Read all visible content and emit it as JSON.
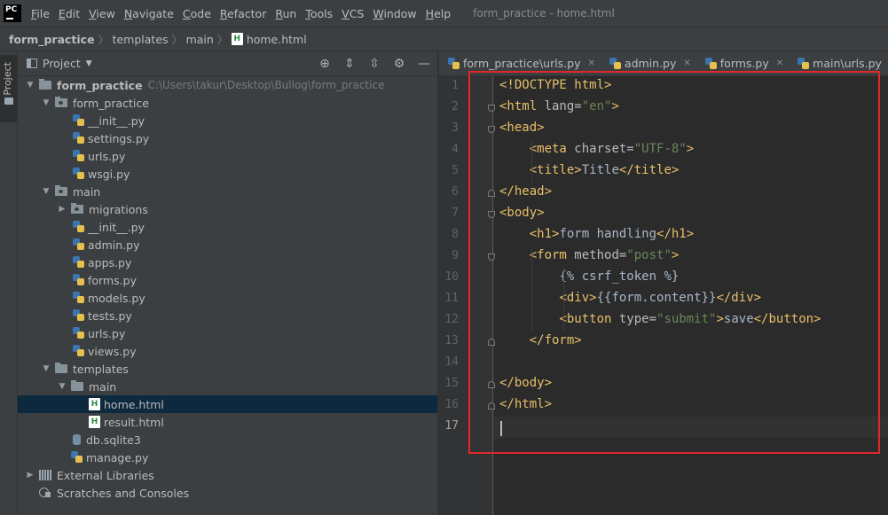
{
  "app": {
    "logo": "PC",
    "window_title": "form_practice - home.html"
  },
  "menu": [
    "File",
    "Edit",
    "View",
    "Navigate",
    "Code",
    "Refactor",
    "Run",
    "Tools",
    "VCS",
    "Window",
    "Help"
  ],
  "breadcrumb": [
    "form_practice",
    "templates",
    "main",
    "home.html"
  ],
  "sidebar_stripe": {
    "label": "Project"
  },
  "project_panel": {
    "title": "Project",
    "tree": [
      {
        "label": "form_practice",
        "path": "C:\\Users\\takur\\Desktop\\Bullog\\form_practice",
        "bold": true,
        "depth": 0,
        "expanded": true,
        "icon": "folder"
      },
      {
        "label": "form_practice",
        "depth": 1,
        "expanded": true,
        "icon": "package"
      },
      {
        "label": "__init__.py",
        "depth": 3,
        "icon": "python"
      },
      {
        "label": "settings.py",
        "depth": 3,
        "icon": "python"
      },
      {
        "label": "urls.py",
        "depth": 3,
        "icon": "python"
      },
      {
        "label": "wsgi.py",
        "depth": 3,
        "icon": "python"
      },
      {
        "label": "main",
        "depth": 1,
        "expanded": true,
        "icon": "package"
      },
      {
        "label": "migrations",
        "depth": 2,
        "expanded": false,
        "icon": "package"
      },
      {
        "label": "__init__.py",
        "depth": 3,
        "icon": "python"
      },
      {
        "label": "admin.py",
        "depth": 3,
        "icon": "python"
      },
      {
        "label": "apps.py",
        "depth": 3,
        "icon": "python"
      },
      {
        "label": "forms.py",
        "depth": 3,
        "icon": "python"
      },
      {
        "label": "models.py",
        "depth": 3,
        "icon": "python"
      },
      {
        "label": "tests.py",
        "depth": 3,
        "icon": "python"
      },
      {
        "label": "urls.py",
        "depth": 3,
        "icon": "python"
      },
      {
        "label": "views.py",
        "depth": 3,
        "icon": "python"
      },
      {
        "label": "templates",
        "depth": 1,
        "expanded": true,
        "icon": "folder"
      },
      {
        "label": "main",
        "depth": 2,
        "expanded": true,
        "icon": "folder"
      },
      {
        "label": "home.html",
        "depth": 4,
        "icon": "html",
        "selected": true
      },
      {
        "label": "result.html",
        "depth": 4,
        "icon": "html"
      },
      {
        "label": "db.sqlite3",
        "depth": 2,
        "icon": "db"
      },
      {
        "label": "manage.py",
        "depth": 2,
        "icon": "python"
      },
      {
        "label": "External Libraries",
        "depth": 0,
        "expanded": false,
        "icon": "library"
      },
      {
        "label": "Scratches and Consoles",
        "depth": 0,
        "icon": "scratch"
      }
    ]
  },
  "tabs": [
    {
      "label": "form_practice\\urls.py"
    },
    {
      "label": "admin.py"
    },
    {
      "label": "forms.py"
    },
    {
      "label": "main\\urls.py"
    }
  ],
  "editor": {
    "line_numbers": [
      "1",
      "2",
      "3",
      "4",
      "5",
      "6",
      "7",
      "8",
      "9",
      "10",
      "11",
      "12",
      "13",
      "14",
      "15",
      "16",
      "17"
    ],
    "current_line": 17,
    "lines": [
      [
        {
          "t": "tag",
          "v": "<!DOCTYPE html>"
        }
      ],
      [
        {
          "t": "tag",
          "v": "<html "
        },
        {
          "t": "attr",
          "v": "lang="
        },
        {
          "t": "val",
          "v": "\"en\""
        },
        {
          "t": "tag",
          "v": ">"
        }
      ],
      [
        {
          "t": "tag",
          "v": "<head>"
        }
      ],
      [
        {
          "t": "txt",
          "v": "    "
        },
        {
          "t": "tag",
          "v": "<meta "
        },
        {
          "t": "attr",
          "v": "charset="
        },
        {
          "t": "val",
          "v": "\"UTF-8\""
        },
        {
          "t": "tag",
          "v": ">"
        }
      ],
      [
        {
          "t": "txt",
          "v": "    "
        },
        {
          "t": "tag",
          "v": "<title>"
        },
        {
          "t": "txt",
          "v": "Title"
        },
        {
          "t": "tag",
          "v": "</title>"
        }
      ],
      [
        {
          "t": "tag",
          "v": "</head>"
        }
      ],
      [
        {
          "t": "tag",
          "v": "<body>"
        }
      ],
      [
        {
          "t": "txt",
          "v": "    "
        },
        {
          "t": "tag",
          "v": "<h1>"
        },
        {
          "t": "txt",
          "v": "form handling"
        },
        {
          "t": "tag",
          "v": "</h1>"
        }
      ],
      [
        {
          "t": "txt",
          "v": "    "
        },
        {
          "t": "tag",
          "v": "<form "
        },
        {
          "t": "attr",
          "v": "method="
        },
        {
          "t": "val",
          "v": "\"post\""
        },
        {
          "t": "tag",
          "v": ">"
        }
      ],
      [
        {
          "t": "txt",
          "v": "        "
        },
        {
          "t": "tmpl",
          "v": "{% csrf_token %}"
        }
      ],
      [
        {
          "t": "txt",
          "v": "        "
        },
        {
          "t": "tag",
          "v": "<div>"
        },
        {
          "t": "tmpl",
          "v": "{{form.content}}"
        },
        {
          "t": "tag",
          "v": "</div>"
        }
      ],
      [
        {
          "t": "txt",
          "v": "        "
        },
        {
          "t": "tag",
          "v": "<button "
        },
        {
          "t": "attr",
          "v": "type="
        },
        {
          "t": "val",
          "v": "\"submit\""
        },
        {
          "t": "tag",
          "v": ">"
        },
        {
          "t": "txt",
          "v": "save"
        },
        {
          "t": "tag",
          "v": "</button>"
        }
      ],
      [
        {
          "t": "txt",
          "v": "    "
        },
        {
          "t": "tag",
          "v": "</form>"
        }
      ],
      [],
      [
        {
          "t": "tag",
          "v": "</body>"
        }
      ],
      [
        {
          "t": "tag",
          "v": "</html>"
        }
      ],
      []
    ]
  }
}
